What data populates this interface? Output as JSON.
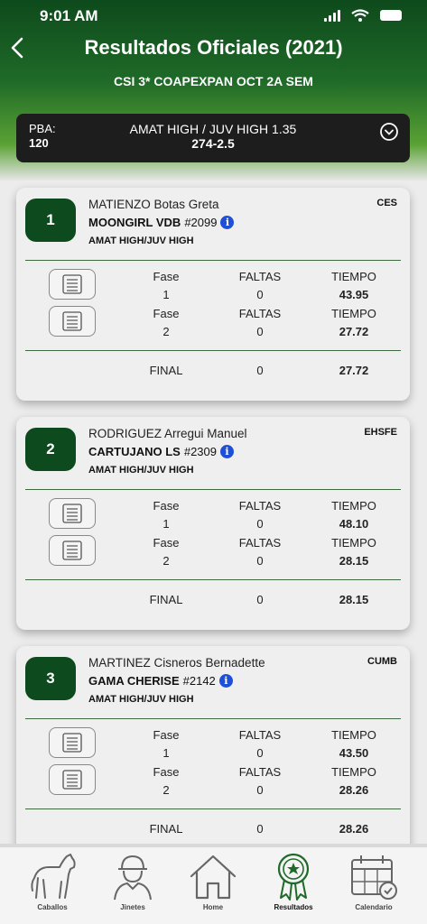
{
  "status": {
    "time": "9:01 AM"
  },
  "header": {
    "title": "Resultados Oficiales (2021)",
    "subtitle": "CSI 3* COAPEXPAN OCT 2A SEM"
  },
  "selector": {
    "pba_label": "PBA:",
    "pba_value": "120",
    "class_title": "AMAT HIGH / JUV HIGH 1.35",
    "class_subtitle": "274-2.5"
  },
  "results": [
    {
      "position": "1",
      "rider": "MATIENZO Botas Greta",
      "horse": "MOONGIRL VDB",
      "registration": "#2099",
      "category": "AMAT HIGH/JUV HIGH",
      "team": "CES",
      "rounds": [
        {
          "fase_label": "Fase",
          "faltas_label": "FALTAS",
          "tiempo_label": "TIEMPO",
          "fase": "1",
          "faltas": "0",
          "tiempo": "43.95"
        },
        {
          "fase_label": "Fase",
          "faltas_label": "FALTAS",
          "tiempo_label": "TIEMPO",
          "fase": "2",
          "faltas": "0",
          "tiempo": "27.72"
        }
      ],
      "final": {
        "label": "FINAL",
        "faltas": "0",
        "tiempo": "27.72"
      }
    },
    {
      "position": "2",
      "rider": "RODRIGUEZ Arregui Manuel",
      "horse": "CARTUJANO LS",
      "registration": "#2309",
      "category": "AMAT HIGH/JUV HIGH",
      "team": "EHSFE",
      "rounds": [
        {
          "fase_label": "Fase",
          "faltas_label": "FALTAS",
          "tiempo_label": "TIEMPO",
          "fase": "1",
          "faltas": "0",
          "tiempo": "48.10"
        },
        {
          "fase_label": "Fase",
          "faltas_label": "FALTAS",
          "tiempo_label": "TIEMPO",
          "fase": "2",
          "faltas": "0",
          "tiempo": "28.15"
        }
      ],
      "final": {
        "label": "FINAL",
        "faltas": "0",
        "tiempo": "28.15"
      }
    },
    {
      "position": "3",
      "rider": "MARTINEZ Cisneros Bernadette",
      "horse": "GAMA CHERISE",
      "registration": "#2142",
      "category": "AMAT HIGH/JUV HIGH",
      "team": "CUMB",
      "rounds": [
        {
          "fase_label": "Fase",
          "faltas_label": "FALTAS",
          "tiempo_label": "TIEMPO",
          "fase": "1",
          "faltas": "0",
          "tiempo": "43.50"
        },
        {
          "fase_label": "Fase",
          "faltas_label": "FALTAS",
          "tiempo_label": "TIEMPO",
          "fase": "2",
          "faltas": "0",
          "tiempo": "28.26"
        }
      ],
      "final": {
        "label": "FINAL",
        "faltas": "0",
        "tiempo": "28.26"
      }
    }
  ],
  "nav": {
    "items": [
      {
        "label": "Caballos",
        "icon": "horse-icon"
      },
      {
        "label": "Jinetes",
        "icon": "rider-icon"
      },
      {
        "label": "Home",
        "icon": "home-icon"
      },
      {
        "label": "Resultados",
        "icon": "ribbon-award-icon"
      },
      {
        "label": "Calendario",
        "icon": "calendar-icon"
      }
    ],
    "active": "Resultados"
  },
  "colors": {
    "header_dark": "#0e4a1c",
    "header_light": "#5aa234",
    "position_badge": "#0d4a1d",
    "info_badge": "#1d4fd8",
    "active_nav": "#1f6a28"
  }
}
